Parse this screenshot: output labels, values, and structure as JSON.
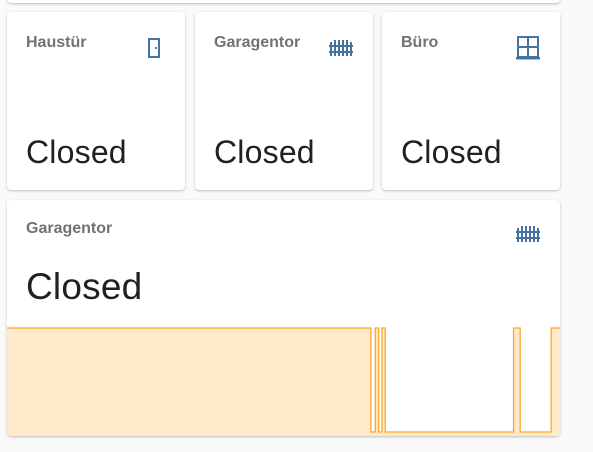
{
  "colors": {
    "icon": "#44739e",
    "history_line": "#ffa726",
    "history_fill": "#ffebcc"
  },
  "cards": [
    {
      "name": "Haustür",
      "state": "Closed",
      "icon": "door-closed-icon"
    },
    {
      "name": "Garagentor",
      "state": "Closed",
      "icon": "gate-icon"
    },
    {
      "name": "Büro",
      "state": "Closed",
      "icon": "window-closed-icon"
    }
  ],
  "history_card": {
    "name": "Garagentor",
    "state": "Closed",
    "icon": "gate-icon",
    "history": [
      {
        "t": 0.0,
        "open": true
      },
      {
        "t": 0.658,
        "open": false
      },
      {
        "t": 0.666,
        "open": true
      },
      {
        "t": 0.672,
        "open": false
      },
      {
        "t": 0.678,
        "open": true
      },
      {
        "t": 0.684,
        "open": false
      },
      {
        "t": 0.916,
        "open": true
      },
      {
        "t": 0.928,
        "open": false
      },
      {
        "t": 0.984,
        "open": true
      },
      {
        "t": 1.0,
        "open": true
      }
    ]
  }
}
